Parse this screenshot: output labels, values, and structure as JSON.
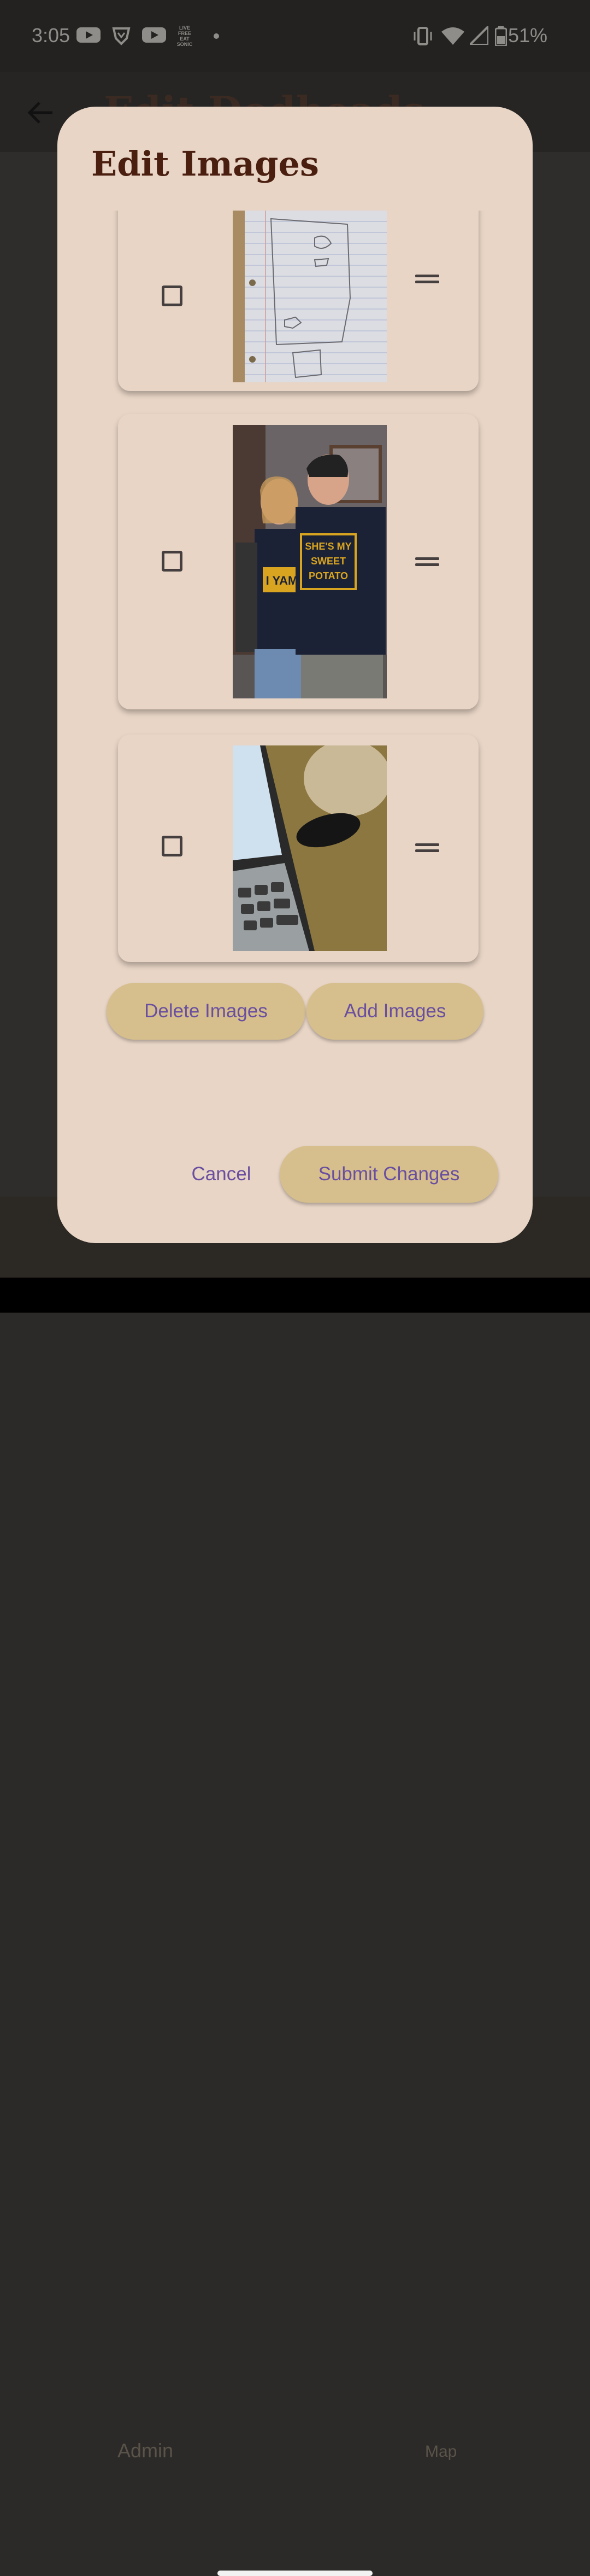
{
  "status_bar": {
    "time": "3:05",
    "notification_icons": [
      "youtube-icon",
      "brave-icon",
      "youtube-icon",
      "live-free-eat-sonic-icon",
      "dot-icon"
    ],
    "notification_badge_text": "LIVE FREE EAT SONIC",
    "system_icons": [
      "vibrate-icon",
      "wifi-icon",
      "signal-icon",
      "battery-icon"
    ],
    "battery": "51%"
  },
  "appbar": {
    "title": "Edit Dodheads"
  },
  "dialog": {
    "title": "Edit Images",
    "images": [
      {
        "description": "hand-drawn map on lined paper",
        "checked": false
      },
      {
        "description": "two people in matching shirts",
        "checked": false,
        "shirt_left": "I YAM",
        "shirt_right": "SHE'S MY SWEET POTATO"
      },
      {
        "description": "laptop keyboard and earbuds case",
        "checked": false
      }
    ],
    "delete_label": "Delete Images",
    "add_label": "Add Images",
    "cancel_label": "Cancel",
    "submit_label": "Submit Changes"
  },
  "bottom_nav": {
    "items": [
      "Admin",
      "Map"
    ]
  },
  "colors": {
    "dialog_bg": "#e8d5c6",
    "title": "#4a1f10",
    "button_bg": "#d6bf8c",
    "button_text": "#6a4fa0"
  }
}
